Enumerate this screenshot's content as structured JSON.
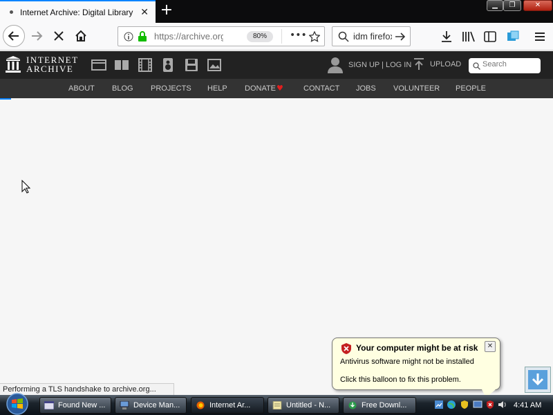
{
  "browser": {
    "tab_title": "Internet Archive: Digital Library of Free & Borrowable Books, Movies, Music & Wayback Machine",
    "url": "https://archive.org",
    "zoom": "80%",
    "search_query": "idm firefox",
    "status_text": "Performing a TLS handshake to archive.org..."
  },
  "ia_header": {
    "logo_line1": "INTERNET",
    "logo_line2": "ARCHIVE",
    "signup_text": "SIGN UP | LOG IN",
    "upload_text": "UPLOAD",
    "search_placeholder": "Search",
    "media_icons": [
      "web-icon",
      "texts-icon",
      "video-icon",
      "audio-icon",
      "software-icon",
      "images-icon"
    ]
  },
  "ia_nav": {
    "items": [
      "ABOUT",
      "BLOG",
      "PROJECTS",
      "HELP",
      "DONATE",
      "CONTACT",
      "JOBS",
      "VOLUNTEER",
      "PEOPLE"
    ]
  },
  "balloon": {
    "title": "Your computer might be at risk",
    "line1": "Antivirus software might not be installed",
    "line2": "Click this balloon to fix this problem."
  },
  "taskbar": {
    "buttons": [
      "Found New ...",
      "Device Man...",
      "Internet Ar...",
      "Untitled - N...",
      "Free Downl..."
    ],
    "clock": "4:41 AM"
  },
  "colors": {
    "accent": "#0a84ff",
    "ia_header": "#222222",
    "ia_nav": "#333333",
    "donate_heart": "#e01e1e",
    "balloon_bg": "#ffffe1"
  }
}
